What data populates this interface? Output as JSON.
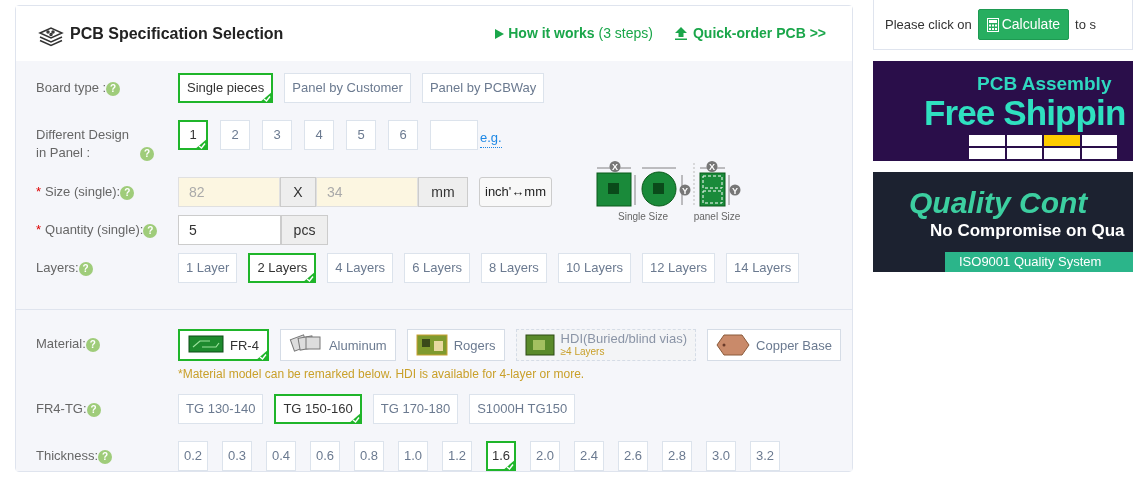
{
  "header": {
    "title": "PCB Specification Selection",
    "how_it_works": {
      "label": "How it works",
      "steps": "(3 steps)"
    },
    "quick_order": {
      "label": "Quick-order PCB",
      "suffix": ">>"
    }
  },
  "sections": [
    {
      "rows": [
        {
          "kind": "options",
          "label": "Board type :",
          "help": "?",
          "options": [
            {
              "label": "Single pieces",
              "selected": true
            },
            {
              "label": "Panel by Customer",
              "selected": false
            },
            {
              "label": "Panel by PCBWay",
              "selected": false
            }
          ]
        },
        {
          "kind": "design",
          "label": "Different Design in Panel :",
          "help": "?",
          "options": [
            {
              "label": "1",
              "selected": true
            },
            {
              "label": "2",
              "selected": false
            },
            {
              "label": "3",
              "selected": false
            },
            {
              "label": "4",
              "selected": false
            },
            {
              "label": "5",
              "selected": false
            },
            {
              "label": "6",
              "selected": false
            }
          ],
          "link": "e.g."
        },
        {
          "kind": "size",
          "label": "Size (single):",
          "required_mark": "*",
          "help": "?",
          "x_value": "82",
          "separator": "X",
          "y_value": "34",
          "unit": "mm",
          "convert": "inch'↔mm"
        },
        {
          "kind": "quantity",
          "label": "Quantity (single):",
          "required_mark": "*",
          "help": "?",
          "value": "5",
          "unit": "pcs"
        },
        {
          "kind": "options",
          "label": "Layers:",
          "help": "?",
          "options": [
            {
              "label": "1 Layer",
              "selected": false
            },
            {
              "label": "2 Layers",
              "selected": true
            },
            {
              "label": "4 Layers",
              "selected": false
            },
            {
              "label": "6 Layers",
              "selected": false
            },
            {
              "label": "8 Layers",
              "selected": false
            },
            {
              "label": "10 Layers",
              "selected": false
            },
            {
              "label": "12 Layers",
              "selected": false
            },
            {
              "label": "14 Layers",
              "selected": false
            }
          ]
        }
      ],
      "size_diagram": {
        "x_mark": "X",
        "y_mark": "Y",
        "single_caption": "Single Size",
        "panel_x_mark": "X",
        "panel_y_mark": "Y",
        "panel_caption": "panel Size"
      }
    },
    {
      "rows": [
        {
          "kind": "material",
          "label": "Material:",
          "help": "?",
          "options": [
            {
              "label": "FR-4",
              "selected": true,
              "disabled": false
            },
            {
              "label": "Aluminum",
              "selected": false,
              "disabled": false
            },
            {
              "label": "Rogers",
              "selected": false,
              "disabled": false
            },
            {
              "label": "HDI(Buried/blind vias)",
              "sub": "≥4 Layers",
              "selected": false,
              "disabled": true
            },
            {
              "label": "Copper Base",
              "selected": false,
              "disabled": false
            }
          ],
          "note": "*Material model can be remarked below. HDI is available for 4-layer or more."
        },
        {
          "kind": "options",
          "label": "FR4-TG:",
          "help": "?",
          "options": [
            {
              "label": "TG 130-140",
              "selected": false
            },
            {
              "label": "TG 150-160",
              "selected": true
            },
            {
              "label": "TG 170-180",
              "selected": false
            },
            {
              "label": "S1000H TG150",
              "selected": false
            }
          ]
        },
        {
          "kind": "small",
          "label": "Thickness:",
          "help": "?",
          "options": [
            {
              "label": "0.2",
              "selected": false
            },
            {
              "label": "0.3",
              "selected": false
            },
            {
              "label": "0.4",
              "selected": false
            },
            {
              "label": "0.6",
              "selected": false
            },
            {
              "label": "0.8",
              "selected": false
            },
            {
              "label": "1.0",
              "selected": false
            },
            {
              "label": "1.2",
              "selected": false
            },
            {
              "label": "1.6",
              "selected": true
            },
            {
              "label": "2.0",
              "selected": false
            },
            {
              "label": "2.4",
              "selected": false
            },
            {
              "label": "2.6",
              "selected": false
            },
            {
              "label": "2.8",
              "selected": false
            },
            {
              "label": "3.0",
              "selected": false
            },
            {
              "label": "3.2",
              "selected": false
            }
          ]
        }
      ]
    }
  ],
  "calculate_card": {
    "before": "Please click on",
    "button": "Calculate",
    "after": "to s"
  },
  "banners": [
    {
      "kind": "shipping",
      "title": "PCB Assembly",
      "headline": "Free Shippin"
    },
    {
      "kind": "quality",
      "headline": "Quality Cont",
      "subtitle": "No Compromise on Qua",
      "ribbon": "ISO9001 Quality System"
    }
  ]
}
